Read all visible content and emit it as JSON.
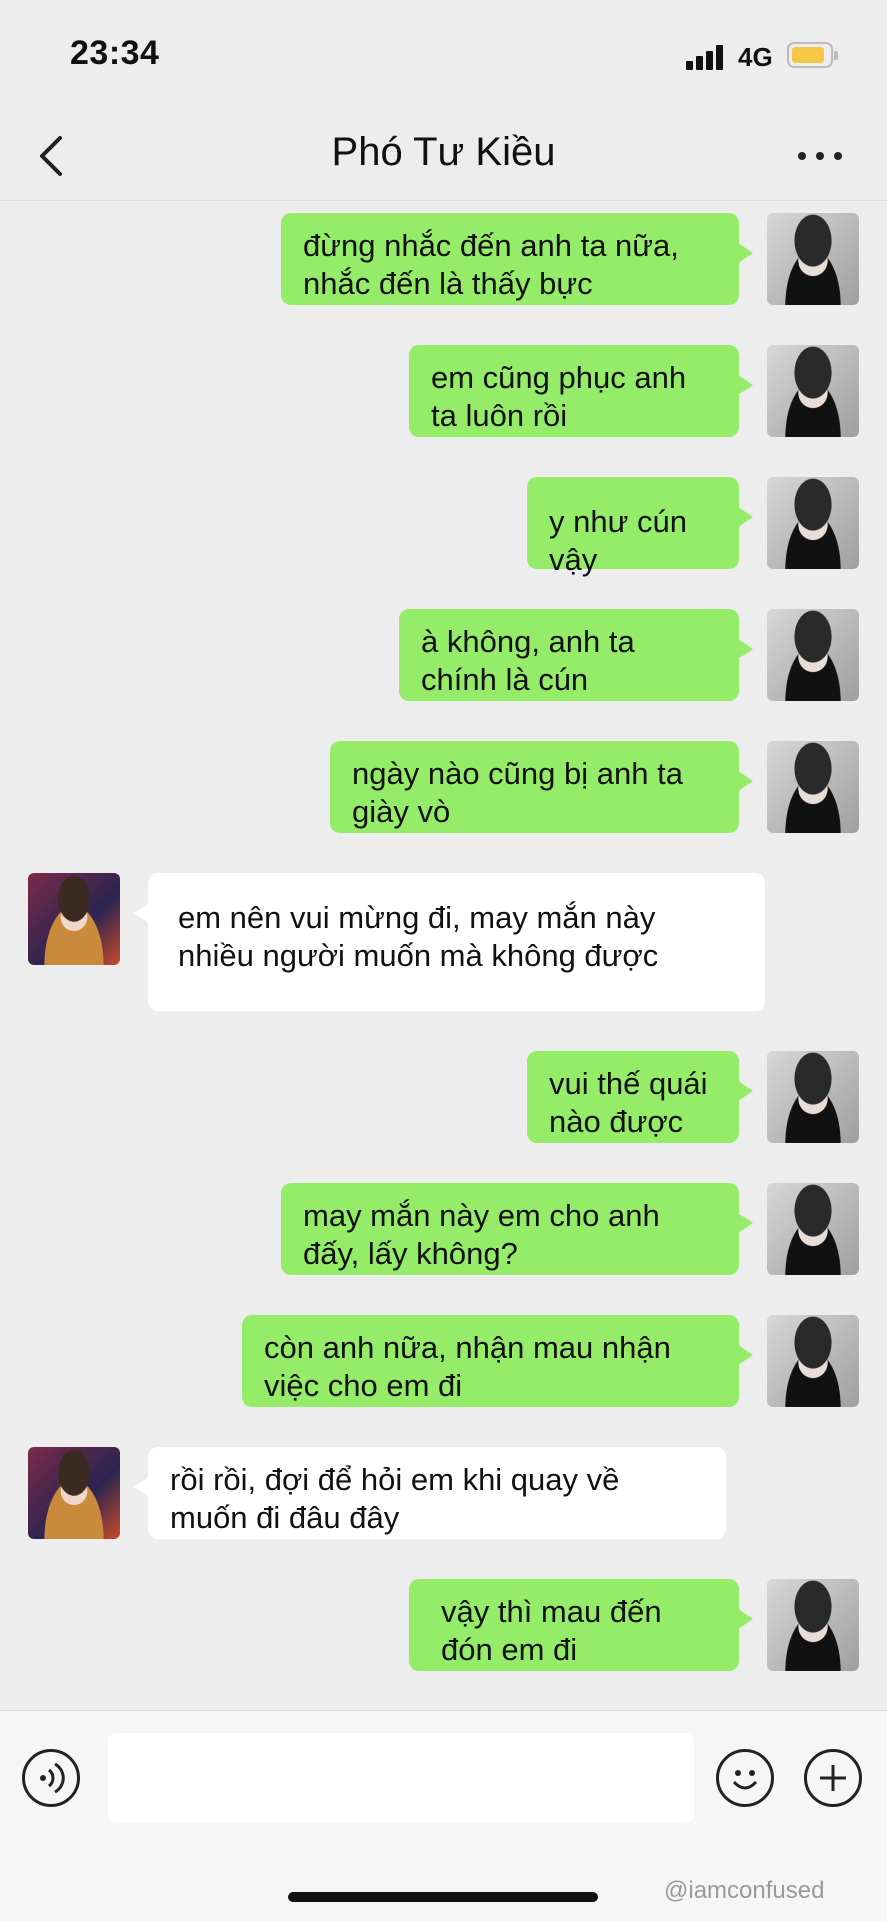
{
  "status_bar": {
    "time": "23:34",
    "network": "4G",
    "battery_color": "#f6c744"
  },
  "nav": {
    "title": "Phó Tư Kiều",
    "back_icon": "chevron-left-icon",
    "more_icon": "more-dots-icon"
  },
  "messages": [
    {
      "side": "me",
      "text": "đừng nhắc đến anh ta nữa,\nnhắc đến là thấy bực"
    },
    {
      "side": "me",
      "text": "em cũng phục anh\nta luôn rồi"
    },
    {
      "side": "me",
      "text": "y như cún vậy"
    },
    {
      "side": "me",
      "text": "à không, anh ta\nchính là cún"
    },
    {
      "side": "me",
      "text": "ngày nào cũng bị anh ta\ngiày vò"
    },
    {
      "side": "friend",
      "text": "em nên vui mừng đi, may mắn này\nnhiều người muốn mà không được"
    },
    {
      "side": "me",
      "text": "vui thế quái\nnào được"
    },
    {
      "side": "me",
      "text": "may mắn này em cho anh\nđấy, lấy không?"
    },
    {
      "side": "me",
      "text": "còn anh nữa, nhận mau nhận\nviệc cho em đi"
    },
    {
      "side": "friend",
      "text": "rồi rồi, đợi để hỏi em khi quay về\nmuốn đi đâu đây"
    },
    {
      "side": "me",
      "text": "vậy thì mau đến\nđón em đi"
    }
  ],
  "input_bar": {
    "voice_icon": "voice-icon",
    "emoji_icon": "emoji-icon",
    "plus_icon": "plus-icon"
  },
  "watermark": "@iamconfused",
  "colors": {
    "sent_bubble": "#95ec69",
    "recv_bubble": "#ffffff",
    "background": "#ededed"
  }
}
